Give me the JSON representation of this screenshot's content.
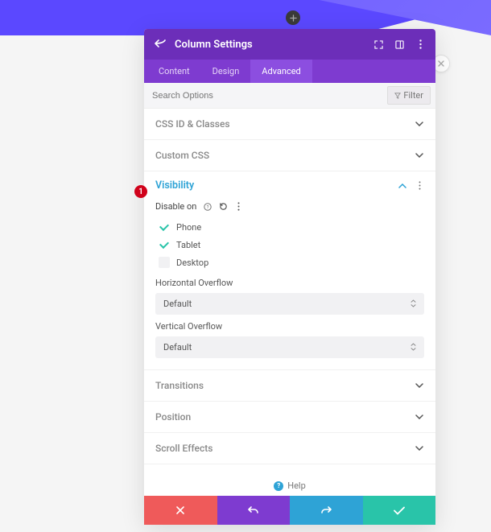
{
  "header": {
    "title": "Column Settings"
  },
  "tabs": [
    {
      "label": "Content",
      "active": false
    },
    {
      "label": "Design",
      "active": false
    },
    {
      "label": "Advanced",
      "active": true
    }
  ],
  "search": {
    "placeholder": "Search Options"
  },
  "filter": {
    "label": "Filter"
  },
  "sections": {
    "css_id_classes": {
      "title": "CSS ID & Classes",
      "expanded": false
    },
    "custom_css": {
      "title": "Custom CSS",
      "expanded": false
    },
    "visibility": {
      "title": "Visibility",
      "expanded": true,
      "disable_on_label": "Disable on",
      "options": [
        {
          "label": "Phone",
          "checked": true
        },
        {
          "label": "Tablet",
          "checked": true
        },
        {
          "label": "Desktop",
          "checked": false
        }
      ],
      "horizontal_overflow": {
        "label": "Horizontal Overflow",
        "value": "Default"
      },
      "vertical_overflow": {
        "label": "Vertical Overflow",
        "value": "Default"
      }
    },
    "transitions": {
      "title": "Transitions",
      "expanded": false
    },
    "position": {
      "title": "Position",
      "expanded": false
    },
    "scroll_effects": {
      "title": "Scroll Effects",
      "expanded": false
    }
  },
  "help": {
    "label": "Help"
  },
  "annotation": {
    "badge": "1"
  }
}
